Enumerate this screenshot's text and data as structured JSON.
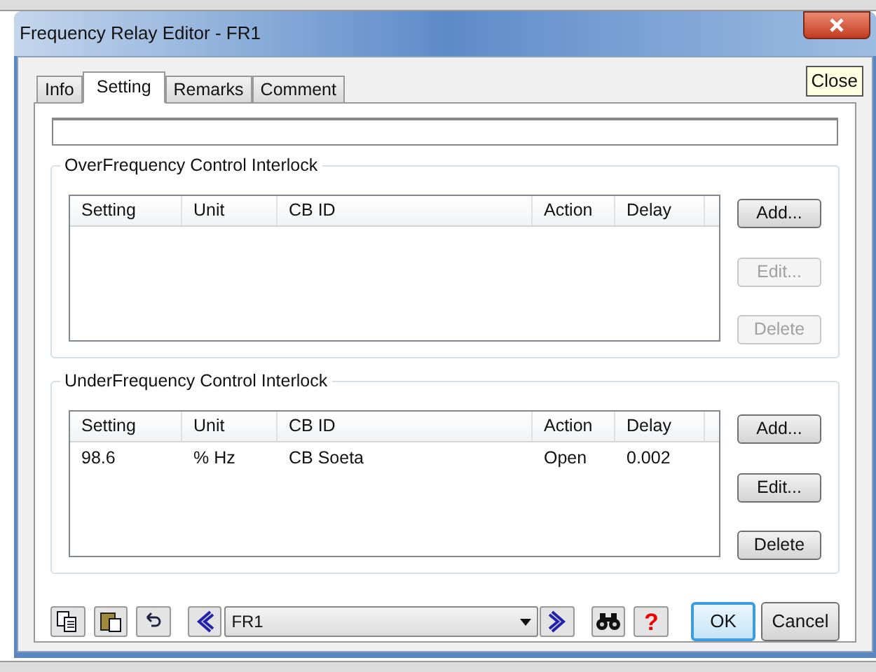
{
  "window": {
    "title": "Frequency Relay Editor - FR1",
    "close_tooltip": "Close"
  },
  "tabs": [
    {
      "label": "Info",
      "selected": false
    },
    {
      "label": "Setting",
      "selected": true
    },
    {
      "label": "Remarks",
      "selected": false
    },
    {
      "label": "Comment",
      "selected": false
    }
  ],
  "groups": [
    {
      "title": "OverFrequency Control Interlock",
      "columns": [
        "Setting",
        "Unit",
        "CB ID",
        "Action",
        "Delay"
      ],
      "buttons": [
        {
          "label": "Add...",
          "disabled": false
        },
        {
          "label": "Edit...",
          "disabled": true
        },
        {
          "label": "Delete",
          "disabled": true
        }
      ]
    },
    {
      "title": "UnderFrequency Control Interlock",
      "columns": [
        "Setting",
        "Unit",
        "CB ID",
        "Action",
        "Delay"
      ],
      "rows": [
        [
          "98.6",
          "% Hz",
          "CB Soeta",
          "Open",
          "0.002"
        ]
      ],
      "buttons": [
        {
          "label": "Add...",
          "disabled": false
        },
        {
          "label": "Edit...",
          "disabled": false
        },
        {
          "label": "Delete",
          "disabled": false
        }
      ]
    }
  ],
  "toolbar": {
    "record": "FR1",
    "help": "?"
  },
  "buttons": [
    {
      "label": "OK",
      "kind": "default"
    },
    {
      "label": "Cancel",
      "kind": "normal"
    }
  ]
}
